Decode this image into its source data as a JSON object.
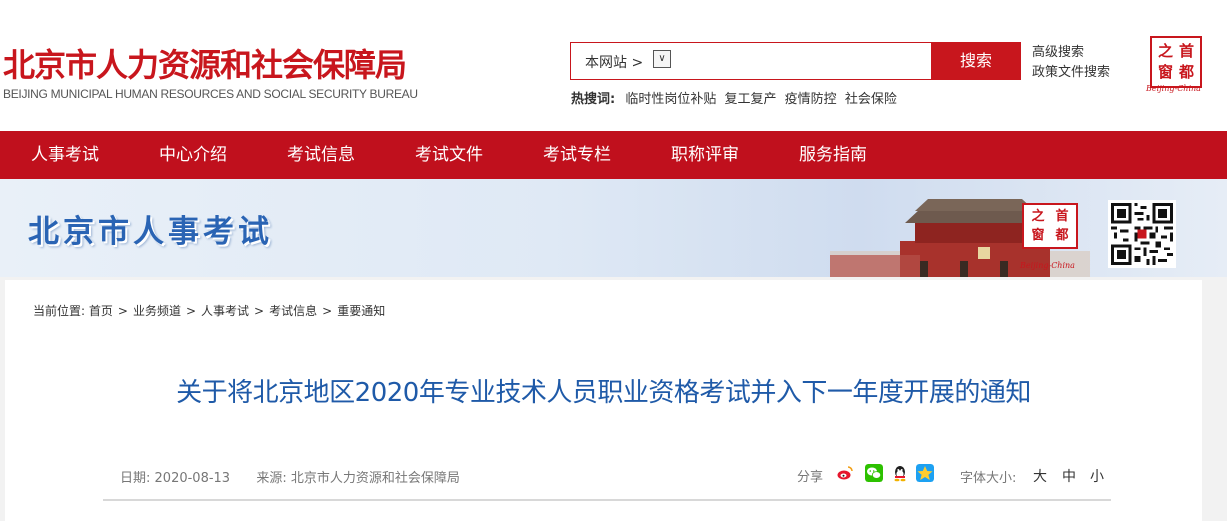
{
  "header": {
    "title": "北京市人力资源和社会保障局",
    "subtitle_en": "BEIJING MUNICIPAL HUMAN RESOURCES AND SOCIAL SECURITY BUREAU",
    "search": {
      "scope_label": "本网站 >",
      "scope_arrow": "∨",
      "value": "",
      "button_label": "搜索"
    },
    "hot_search": {
      "label": "热搜词:",
      "terms": [
        "临时性岗位补贴",
        "复工复产",
        "疫情防控",
        "社会保险"
      ]
    },
    "links": {
      "advanced_search": "高级搜索",
      "policy_search": "政策文件搜索"
    },
    "logo": {
      "chars": [
        "之",
        "首",
        "窗",
        "都"
      ],
      "caption": "Beijing-China"
    }
  },
  "nav": {
    "items": [
      "人事考试",
      "中心介绍",
      "考试信息",
      "考试文件",
      "考试专栏",
      "职称评审",
      "服务指南"
    ]
  },
  "banner": {
    "title": "北京市人事考试",
    "logo_chars": [
      "之",
      "首",
      "窗",
      "都"
    ],
    "logo_caption": "Beijing-China"
  },
  "breadcrumb": {
    "label": "当前位置:",
    "items": [
      "首页",
      "业务频道",
      "人事考试",
      "考试信息",
      "重要通知"
    ]
  },
  "article": {
    "title": "关于将北京地区2020年专业技术人员职业资格考试并入下一年度开展的通知",
    "date_label": "日期:",
    "date": "2020-08-13",
    "source_label": "来源:",
    "source": "北京市人力资源和社会保障局",
    "share_label": "分享",
    "share_icons": [
      "weibo-icon",
      "wechat-icon",
      "qq-icon",
      "qzone-icon"
    ],
    "font_size_label": "字体大小:",
    "font_sizes": [
      "大",
      "中",
      "小"
    ]
  },
  "colors": {
    "brand_red": "#c8161d",
    "nav_red": "#c0101d",
    "title_blue": "#1f5aa8",
    "banner_blue": "#2a64b4"
  }
}
